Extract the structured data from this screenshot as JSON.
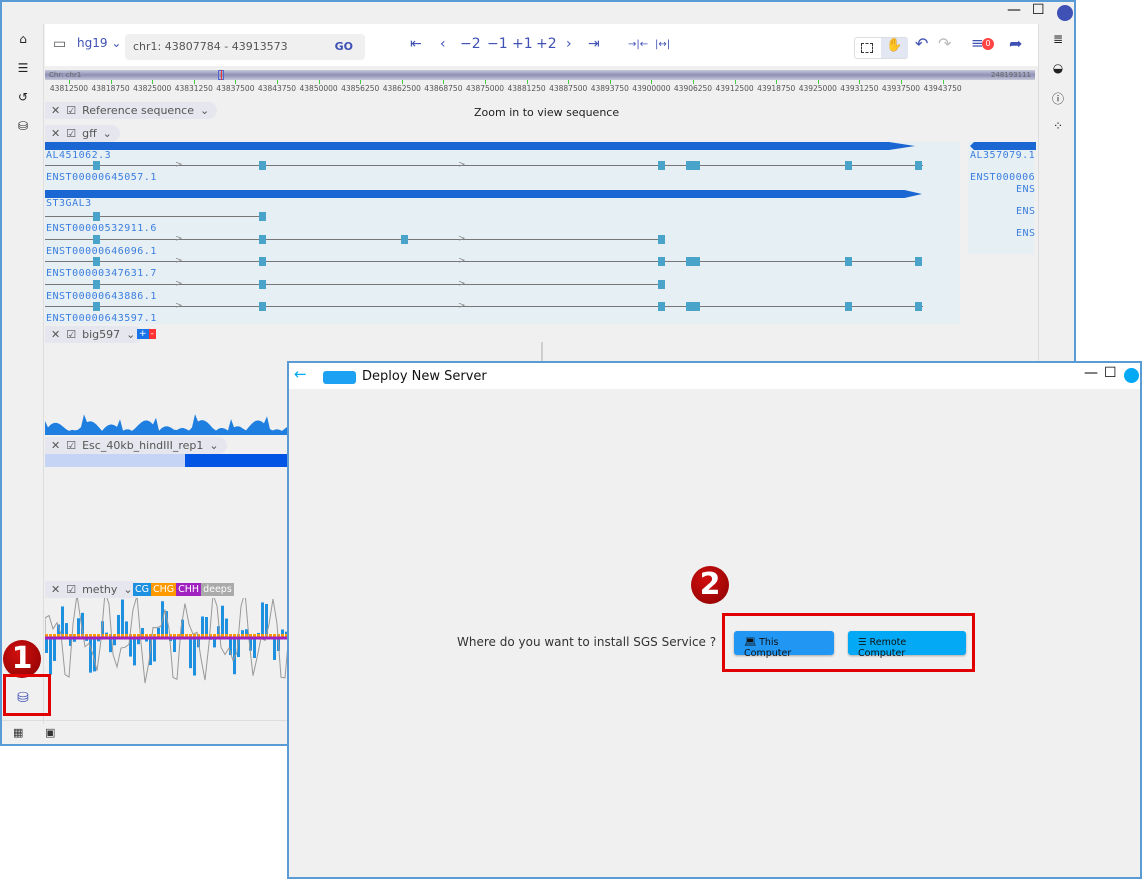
{
  "app": {
    "window_controls": {
      "minimize": "—",
      "maximize": "☐"
    }
  },
  "sidebar_left": {
    "items": [
      "home",
      "tracks",
      "history",
      "search-data"
    ],
    "bottom": [
      "grid",
      "calendar"
    ]
  },
  "toolbar": {
    "genome": "hg19",
    "genome_chevron": "⌄",
    "location": "chr1: 43807784 - 43913573",
    "go": "GO",
    "nav": [
      "⇤",
      "‹",
      "−2",
      "−1",
      "+1",
      "+2",
      "›",
      "⇥",
      "→|←",
      "|↔|"
    ],
    "badge_count": "0"
  },
  "ruler": {
    "chr_label": "Chr: chr1",
    "chr_length": "248193111",
    "ticks": [
      "43812500",
      "43818750",
      "43825000",
      "43831250",
      "43837500",
      "43843750",
      "43850000",
      "43856250",
      "43862500",
      "43868750",
      "43875000",
      "43881250",
      "43887500",
      "43893750",
      "43900000",
      "43906250",
      "43912500",
      "43918750",
      "43925000",
      "43931250",
      "43937500",
      "43943750"
    ]
  },
  "tracks": {
    "reference": {
      "name": "Reference sequence",
      "message": "Zoom in to view sequence"
    },
    "gff": {
      "name": "gff",
      "genes": [
        {
          "label": "AL451062.3"
        },
        {
          "label": "ENST00000645057.1"
        },
        {
          "label": "ST3GAL3"
        },
        {
          "label": "ENST00000532911.6"
        },
        {
          "label": "ENST00000646096.1"
        },
        {
          "label": "ENST00000347631.7"
        },
        {
          "label": "ENST00000643886.1"
        },
        {
          "label": "ENST00000643597.1"
        }
      ],
      "right_genes": [
        "AL357079.1",
        "ENST000006",
        "ENS",
        "ENS",
        "ENS"
      ]
    },
    "big597": {
      "name": "big597",
      "strand_plus": "+",
      "strand_minus": "-"
    },
    "hic": {
      "name": "Esc_40kb_hindIII_rep1"
    },
    "methy": {
      "name": "methy",
      "legend": [
        {
          "label": "CG",
          "color": "#1e90e0"
        },
        {
          "label": "CHG",
          "color": "#ff9900"
        },
        {
          "label": "CHH",
          "color": "#a020c0"
        },
        {
          "label": "deeps",
          "color": "#aaaaaa"
        }
      ]
    }
  },
  "dialog": {
    "title": "Deploy New Server",
    "back": "←",
    "question": "Where do you want to install SGS Service ?",
    "buttons": [
      {
        "label": "This Computer",
        "color": "#2196f3"
      },
      {
        "label": "Remote Computer",
        "color": "#03a9f4"
      }
    ]
  },
  "annotations": {
    "step1": "1",
    "step2": "2"
  }
}
